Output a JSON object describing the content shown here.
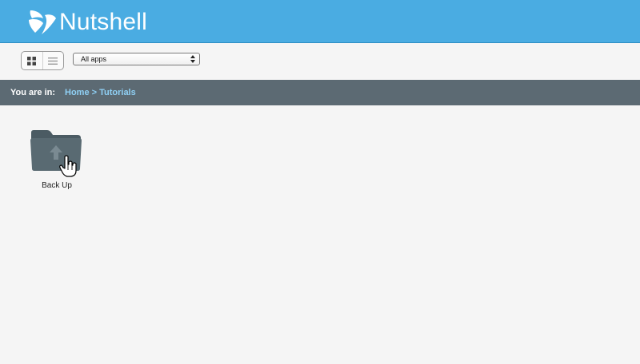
{
  "app": {
    "name": "Nutshell",
    "brand_color": "#4aace2"
  },
  "toolbar": {
    "view_modes": [
      "grid-view",
      "list-view"
    ],
    "active_view": "grid-view",
    "app_filter": {
      "selected": "All apps"
    }
  },
  "location": {
    "label": "You are in:",
    "breadcrumb": "Home > Tutorials"
  },
  "items": [
    {
      "label": "Back Up",
      "icon": "folder-up-icon"
    }
  ]
}
